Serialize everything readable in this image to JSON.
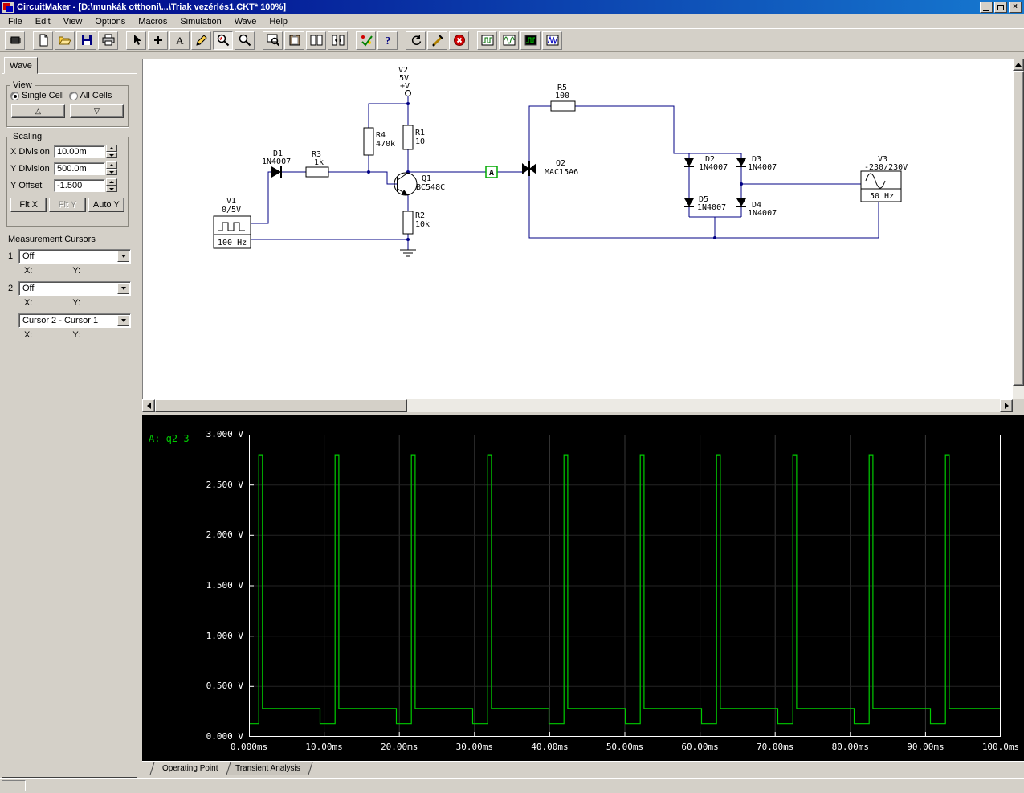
{
  "window": {
    "title": "CircuitMaker - [D:\\munkák otthoni\\...\\Triak vezérlés1.CKT* 100%]"
  },
  "menu": {
    "items": [
      "File",
      "Edit",
      "View",
      "Options",
      "Macros",
      "Simulation",
      "Wave",
      "Help"
    ]
  },
  "toolbar": {
    "buttons": [
      {
        "name": "part-browser-button",
        "icon": "chip"
      },
      {
        "sep": true
      },
      {
        "name": "new-file-button",
        "icon": "newfile"
      },
      {
        "name": "open-file-button",
        "icon": "open"
      },
      {
        "name": "save-button",
        "icon": "save"
      },
      {
        "name": "print-button",
        "icon": "print"
      },
      {
        "sep": true
      },
      {
        "name": "select-tool",
        "icon": "arrow"
      },
      {
        "name": "wire-tool",
        "icon": "plus"
      },
      {
        "name": "text-tool",
        "icon": "textA"
      },
      {
        "name": "delete-tool",
        "icon": "pencil"
      },
      {
        "name": "probe-tool",
        "icon": "probe",
        "active": true
      },
      {
        "name": "zoom-tool",
        "icon": "zoom"
      },
      {
        "sep": true
      },
      {
        "name": "fit-window-button",
        "icon": "zoomwin"
      },
      {
        "name": "copy-button",
        "icon": "clipboard"
      },
      {
        "name": "split-view-button",
        "icon": "panes"
      },
      {
        "name": "pan-view-button",
        "icon": "panesarrow"
      },
      {
        "sep": true
      },
      {
        "name": "run-simulation-button",
        "icon": "runcheck"
      },
      {
        "name": "help-button",
        "icon": "help"
      },
      {
        "sep": true
      },
      {
        "name": "reset-simulation-button",
        "icon": "reset"
      },
      {
        "name": "test-probe-button",
        "icon": "probeY"
      },
      {
        "name": "stop-simulation-button",
        "icon": "stop"
      },
      {
        "sep": true
      },
      {
        "name": "scope-window-button",
        "icon": "scope1"
      },
      {
        "name": "waveform-window-button",
        "icon": "scope2"
      },
      {
        "name": "digital-scope-button",
        "icon": "scope3"
      },
      {
        "name": "signal-window-button",
        "icon": "scope4"
      }
    ]
  },
  "sidebar": {
    "tab_label": "Wave",
    "view": {
      "title": "View",
      "single_cell": "Single Cell",
      "all_cells": "All Cells",
      "selected": "Single Cell",
      "up_icon": "△",
      "down_icon": "▽"
    },
    "scaling": {
      "title": "Scaling",
      "x_division_label": "X Division",
      "x_division": "10.00m",
      "y_division_label": "Y Division",
      "y_division": "500.0m",
      "y_offset_label": "Y Offset",
      "y_offset": "-1.500",
      "fit_x": "Fit X",
      "fit_y": "Fit Y",
      "auto_y": "Auto Y"
    },
    "cursors": {
      "title": "Measurement Cursors",
      "cursor1_label": "1",
      "cursor1_value": "Off",
      "cursor2_label": "2",
      "cursor2_value": "Off",
      "delta_value": "Cursor 2 - Cursor 1",
      "x_label": "X:",
      "y_label": "Y:"
    }
  },
  "schematic": {
    "v1": {
      "ref": "V1",
      "value": "0/5V",
      "freq": "100 Hz"
    },
    "v2": {
      "ref": "V2",
      "value": "5V",
      "rail": "+V"
    },
    "v3": {
      "ref": "V3",
      "value": "-230/230V",
      "freq": "50 Hz"
    },
    "r1": {
      "ref": "R1",
      "value": "10"
    },
    "r2": {
      "ref": "R2",
      "value": "10k"
    },
    "r3": {
      "ref": "R3",
      "value": "1k"
    },
    "r4": {
      "ref": "R4",
      "value": "470k"
    },
    "r5": {
      "ref": "R5",
      "value": "100"
    },
    "d1": {
      "ref": "D1",
      "value": "1N4007"
    },
    "d2": {
      "ref": "D2",
      "value": "1N4007"
    },
    "d3": {
      "ref": "D3",
      "value": "1N4007"
    },
    "d4": {
      "ref": "D4",
      "value": "1N4007"
    },
    "d5": {
      "ref": "D5",
      "value": "1N4007"
    },
    "q1": {
      "ref": "Q1",
      "value": "BC548C"
    },
    "q2": {
      "ref": "Q2",
      "value": "MAC15A6"
    },
    "probe": {
      "label": "A"
    }
  },
  "tabs": {
    "items": [
      {
        "label": "Operating Point",
        "active": true,
        "name": "tab-operating-point"
      },
      {
        "label": "Transient Analysis",
        "active": false,
        "name": "tab-transient-analysis"
      }
    ]
  },
  "chart_data": {
    "type": "line",
    "trace_label": "A: q2_3",
    "trace_color": "#00cc00",
    "background": "#000000",
    "grid": true,
    "xlim_ms": [
      0,
      100
    ],
    "ylim_v": [
      0,
      3
    ],
    "y_ticks": [
      "3.000 V",
      "2.500 V",
      "2.000 V",
      "1.500 V",
      "1.000 V",
      "0.500 V",
      "0.000 V"
    ],
    "x_ticks": [
      "0.000ms",
      "10.00ms",
      "20.00ms",
      "30.00ms",
      "40.00ms",
      "50.00ms",
      "60.00ms",
      "70.00ms",
      "80.00ms",
      "90.00ms",
      "100.0ms"
    ],
    "waveform": {
      "shape": "periodic trigger pulses",
      "first_pulse_ms": 1.3,
      "period_ms": 10.15,
      "pulse_count": 10,
      "pulse_width_ms": 0.5,
      "peak_v": 2.8,
      "baseline_v": 0.28,
      "predip_v": 0.13,
      "predip_duration_ms": 2.0
    }
  }
}
